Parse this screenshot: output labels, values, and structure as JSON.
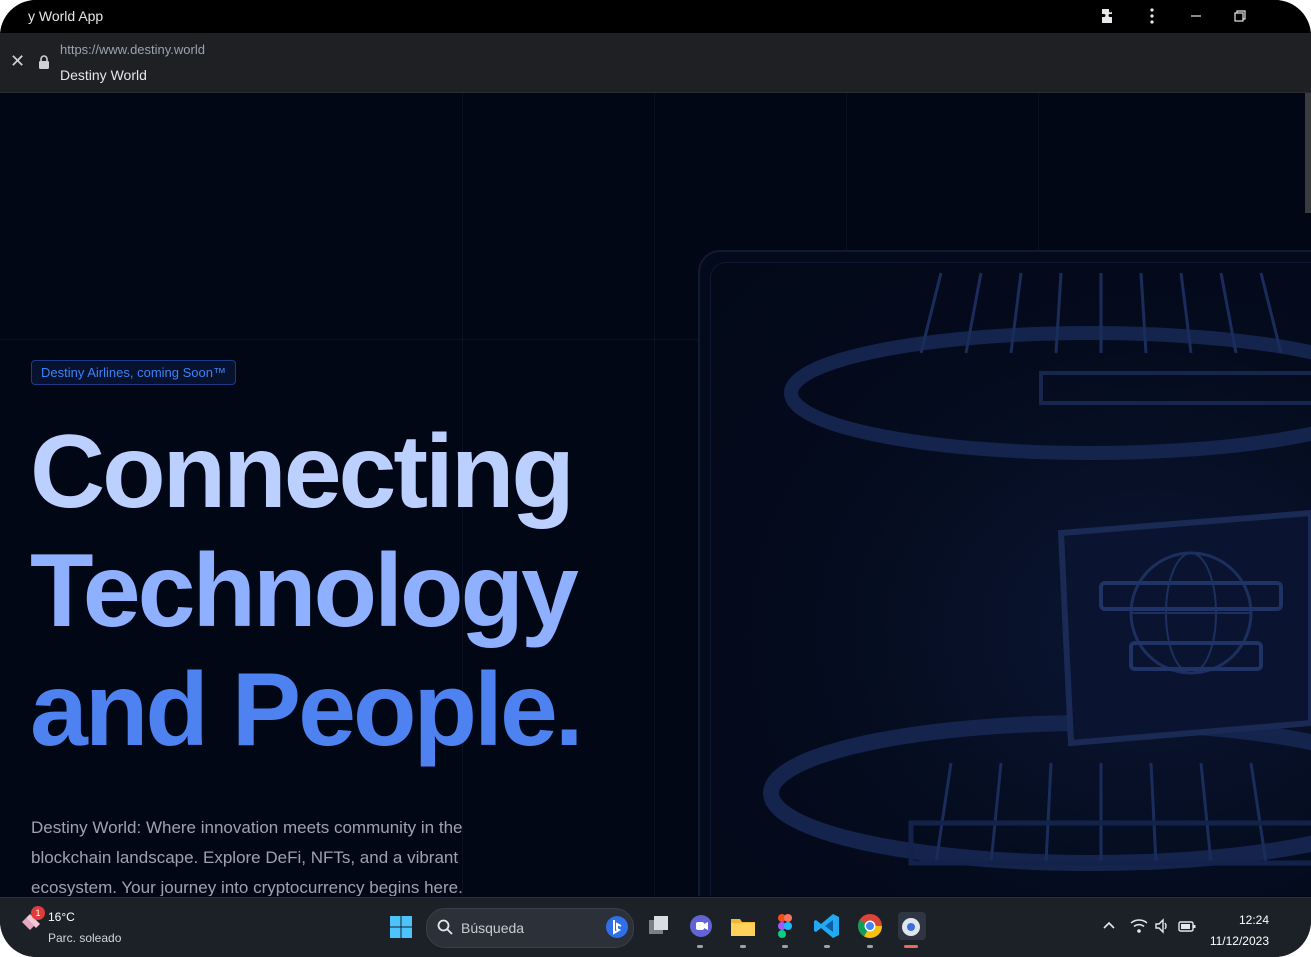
{
  "window": {
    "title": "y World App"
  },
  "browser": {
    "url": "https://www.destiny.world",
    "page_title": "Destiny World"
  },
  "hero": {
    "badge": "Destiny Airlines, coming Soon™",
    "headline_line1": "Connecting",
    "headline_line2": "Technology",
    "headline_line3": "and People.",
    "description": "Destiny World: Where innovation meets community in the blockchain landscape. Explore DeFi, NFTs, and a vibrant ecosystem. Your journey into cryptocurrency begins here."
  },
  "taskbar": {
    "weather_badge": "1",
    "weather_temp": "16°C",
    "weather_condition": "Parc. soleado",
    "search_placeholder": "Búsqueda",
    "time": "12:24",
    "date": "11/12/2023"
  },
  "icons": [
    "extensions-icon",
    "more-options-icon",
    "minimize-icon",
    "restore-icon",
    "close-icon",
    "lock-icon",
    "windows-start-icon",
    "search-icon",
    "bing-icon",
    "task-view-icon",
    "teams-icon",
    "file-explorer-icon",
    "figma-icon",
    "vscode-icon",
    "chrome-icon",
    "app-icon",
    "chevron-up-icon",
    "wifi-icon",
    "volume-icon",
    "battery-icon"
  ],
  "colors": {
    "background": "#020716",
    "headline_light": "#bcd0ff",
    "headline_mid": "#8fb0ff",
    "headline_accent": "#4d82f0",
    "badge_text": "#3b82f6"
  }
}
